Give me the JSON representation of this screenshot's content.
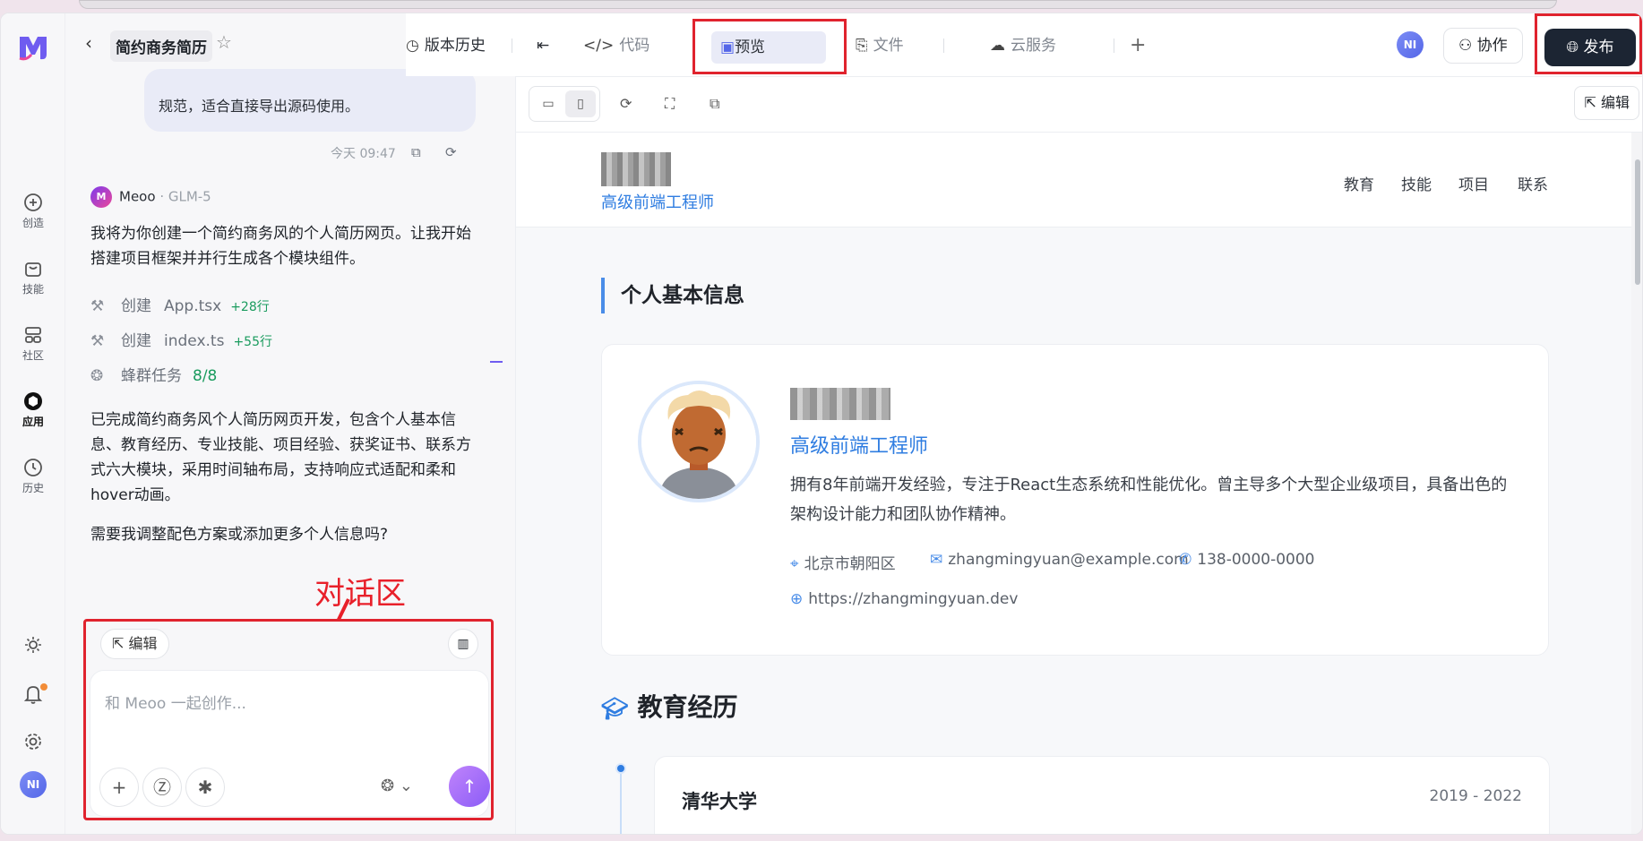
{
  "project": {
    "name": "简约商务简历"
  },
  "rail": {
    "items": [
      {
        "label": "创造",
        "icon": "plus-circle-icon"
      },
      {
        "label": "技能",
        "icon": "bag-icon"
      },
      {
        "label": "社区",
        "icon": "grid-icon"
      },
      {
        "label": "应用",
        "icon": "cube-icon"
      },
      {
        "label": "历史",
        "icon": "clock-icon"
      }
    ],
    "user_initials": "NI"
  },
  "nav": {
    "history": "版本历史",
    "code": "代码",
    "preview": "预览",
    "files": "文件",
    "cloud": "云服务",
    "collab": "协作",
    "publish": "发布",
    "user_initials": "NI"
  },
  "chat": {
    "user_bubble_tail": "规范，适合直接导出源码使用。",
    "timestamp": "今天 09:47",
    "ai_name": "Meoo",
    "ai_model": "· GLM-5",
    "intro": "我将为你创建一个简约商务风的个人简历网页。让我开始搭建项目框架并并行生成各个模块组件。",
    "steps": [
      {
        "action": "创建",
        "file": "App.tsx",
        "delta": "+28行"
      },
      {
        "action": "创建",
        "file": "index.ts",
        "delta": "+55行"
      }
    ],
    "swarm": {
      "label": "蜂群任务",
      "count": "8/8"
    },
    "summary": "已完成简约商务风个人简历网页开发，包含个人基本信息、教育经历、专业技能、项目经验、获奖证书、联系方式六大模块，采用时间轴布局，支持响应式适配和柔和hover动画。",
    "question": "需要我调整配色方案或添加更多个人信息吗?",
    "annotation": "对话区",
    "edit_chip": "编辑",
    "input_placeholder": "和 Meoo 一起创作..."
  },
  "preview": {
    "edit_label": "编辑",
    "site": {
      "role": "高级前端工程师",
      "nav": [
        "教育",
        "技能",
        "项目",
        "联系"
      ],
      "section_basic": "个人基本信息",
      "card_role": "高级前端工程师",
      "bio": "拥有8年前端开发经验，专注于React生态系统和性能优化。曾主导多个大型企业级项目，具备出色的架构设计能力和团队协作精神。",
      "location": "北京市朝阳区",
      "email": "zhangmingyuan@example.com",
      "phone": "138-0000-0000",
      "website": "https://zhangmingyuan.dev",
      "section_edu": "教育经历",
      "edu": {
        "school": "清华大学",
        "years": "2019 - 2022"
      }
    }
  },
  "colors": {
    "accent": "#2f7de1",
    "annotation": "#e0232e",
    "publish_bg": "#1c2533"
  }
}
